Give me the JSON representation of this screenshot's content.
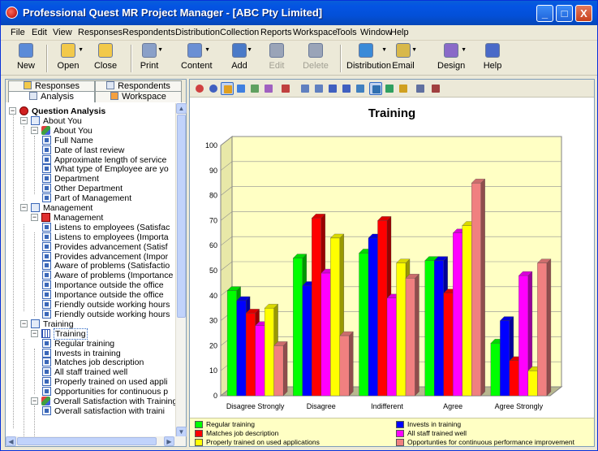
{
  "window": {
    "title": "Professional Quest MR Project Manager - [ABC Pty Limited]",
    "minimize": "_",
    "maximize": "□",
    "close": "X"
  },
  "menu": [
    "File",
    "Edit",
    "View",
    "Responses",
    "Respondents",
    "Distribution",
    "Collection",
    "Reports",
    "Workspace",
    "Tools",
    "Window",
    "Help"
  ],
  "toolbar": [
    {
      "label": "New",
      "icon": "new-document-icon",
      "color": "#5b8bd8",
      "disabled": false
    },
    {
      "label": "Open",
      "icon": "open-folder-icon",
      "color": "#f2c94a",
      "disabled": false
    },
    {
      "label": "Close",
      "icon": "close-document-icon",
      "color": "#f2c94a",
      "disabled": false
    },
    {
      "label": "Print",
      "icon": "printer-icon",
      "color": "#8aa0c8",
      "disabled": false
    },
    {
      "label": "Content",
      "icon": "content-icon",
      "color": "#6a8fd4",
      "disabled": false
    },
    {
      "label": "Add",
      "icon": "add-question-icon",
      "color": "#4a7ac8",
      "disabled": false
    },
    {
      "label": "Edit",
      "icon": "edit-question-icon",
      "color": "#9aa4b8",
      "disabled": true
    },
    {
      "label": "Delete",
      "icon": "delete-question-icon",
      "color": "#9aa4b8",
      "disabled": true
    },
    {
      "label": "Distribution",
      "icon": "distribution-globe-icon",
      "color": "#3a8ad8",
      "disabled": false
    },
    {
      "label": "Email",
      "icon": "email-icon",
      "color": "#d8b84a",
      "disabled": false
    },
    {
      "label": "Design",
      "icon": "design-icon",
      "color": "#8a6ac8",
      "disabled": false
    },
    {
      "label": "Help",
      "icon": "help-icon",
      "color": "#4a6ac8",
      "disabled": false
    }
  ],
  "tabs": {
    "responses": "Responses",
    "respondents": "Respondents",
    "analysis": "Analysis",
    "workspace": "Workspace"
  },
  "tree": [
    {
      "text": "Question Analysis",
      "level": 0,
      "icon": "root",
      "toggle": "-",
      "bold": true
    },
    {
      "text": "About You",
      "level": 1,
      "icon": "sect",
      "toggle": "-"
    },
    {
      "text": "About You",
      "level": 2,
      "icon": "grp",
      "toggle": "-"
    },
    {
      "text": "Full Name",
      "level": 3,
      "icon": "q"
    },
    {
      "text": "Date of last review",
      "level": 3,
      "icon": "q"
    },
    {
      "text": "Approximate length of service",
      "level": 3,
      "icon": "q"
    },
    {
      "text": "What type of Employee are yo",
      "level": 3,
      "icon": "q"
    },
    {
      "text": "Department",
      "level": 3,
      "icon": "q"
    },
    {
      "text": "Other Department",
      "level": 3,
      "icon": "q"
    },
    {
      "text": "Part of Management",
      "level": 3,
      "icon": "q"
    },
    {
      "text": "Management",
      "level": 1,
      "icon": "sect",
      "toggle": "-"
    },
    {
      "text": "Management",
      "level": 2,
      "icon": "mgrid",
      "toggle": "-"
    },
    {
      "text": "Listens to employees (Satisfac",
      "level": 3,
      "icon": "q"
    },
    {
      "text": "Listens to employees (Importa",
      "level": 3,
      "icon": "q"
    },
    {
      "text": "Provides advancement (Satisf",
      "level": 3,
      "icon": "q"
    },
    {
      "text": "Provides advancement (Impor",
      "level": 3,
      "icon": "q"
    },
    {
      "text": "Aware of problems (Satisfactio",
      "level": 3,
      "icon": "q"
    },
    {
      "text": "Aware of problems (Importance",
      "level": 3,
      "icon": "q"
    },
    {
      "text": "Importance outside the office",
      "level": 3,
      "icon": "q"
    },
    {
      "text": "Importance outside the office",
      "level": 3,
      "icon": "q"
    },
    {
      "text": "Friendly outside working hours",
      "level": 3,
      "icon": "q"
    },
    {
      "text": "Friendly outside working hours",
      "level": 3,
      "icon": "q"
    },
    {
      "text": "Training",
      "level": 1,
      "icon": "sect",
      "toggle": "-"
    },
    {
      "text": "Training",
      "level": 2,
      "icon": "grid",
      "toggle": "-",
      "selected": true
    },
    {
      "text": "Regular training",
      "level": 3,
      "icon": "q"
    },
    {
      "text": "Invests in training",
      "level": 3,
      "icon": "q"
    },
    {
      "text": "Matches job description",
      "level": 3,
      "icon": "q"
    },
    {
      "text": "All staff trained well",
      "level": 3,
      "icon": "q"
    },
    {
      "text": "Properly trained on used appli",
      "level": 3,
      "icon": "q"
    },
    {
      "text": "Opportunities for continuous p",
      "level": 3,
      "icon": "q"
    },
    {
      "text": "Overall Satisfaction with Training",
      "level": 2,
      "icon": "grp",
      "toggle": "-"
    },
    {
      "text": "Overall satisfaction with traini",
      "level": 3,
      "icon": "q"
    }
  ],
  "chart_toolbar": [
    "pie-chart-icon",
    "donut-chart-icon",
    "bar-chart-icon",
    "horizontal-bar-icon",
    "line-chart-icon",
    "area-chart-icon",
    "fill-color-icon",
    "copy-icon",
    "paste-icon",
    "data-table-icon",
    "grid-icon",
    "image-icon",
    "rotate-3d-icon",
    "move-icon",
    "settings-icon",
    "zoom-icon",
    "pointer-icon"
  ],
  "chart_data": {
    "type": "bar",
    "title": "Training",
    "categories": [
      "Disagree Strongly",
      "Disagree",
      "Indifferent",
      "Agree",
      "Agree Strongly"
    ],
    "ylim": [
      0,
      100
    ],
    "yticks": [
      0,
      10,
      20,
      30,
      40,
      50,
      60,
      70,
      80,
      90,
      100
    ],
    "grid": true,
    "legend_position": "bottom",
    "background": "#ffffc4",
    "series": [
      {
        "name": "Regular training",
        "color": "#00ff00",
        "values": [
          42,
          55,
          57,
          54,
          21
        ]
      },
      {
        "name": "Invests in training",
        "color": "#0000ff",
        "values": [
          38,
          44,
          63,
          54,
          30
        ]
      },
      {
        "name": "Matches job description",
        "color": "#ff0000",
        "values": [
          33,
          71,
          70,
          41,
          14
        ]
      },
      {
        "name": "All staff trained well",
        "color": "#ff00ff",
        "values": [
          28,
          49,
          39,
          65,
          48
        ]
      },
      {
        "name": "Properly trained on used applications",
        "color": "#ffff00",
        "values": [
          35,
          63,
          53,
          68,
          10
        ]
      },
      {
        "name": "Opportunties for continuous performance improvement",
        "color": "#f08080",
        "values": [
          20,
          24,
          47,
          85,
          53
        ]
      }
    ]
  }
}
